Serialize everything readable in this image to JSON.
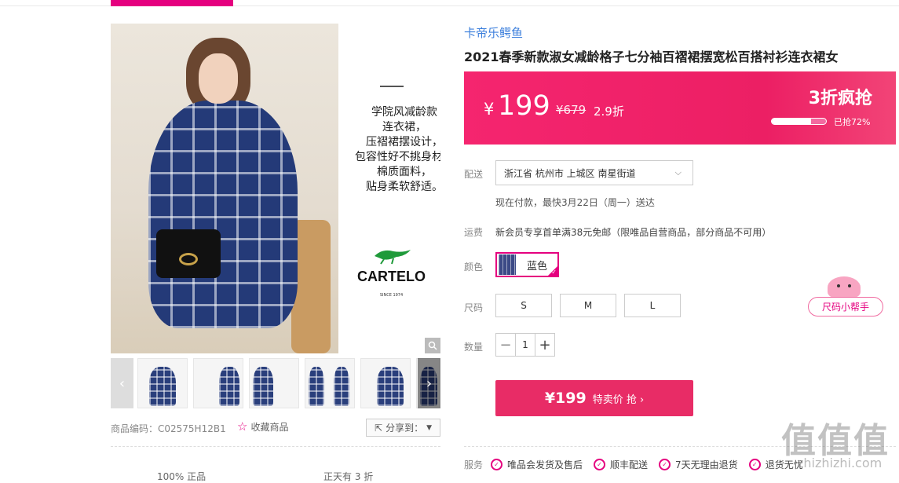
{
  "gallery": {
    "copy_lines": [
      "学院风减龄款",
      "连衣裙，",
      "压褶裙摆设计，",
      "包容性好不挑身材，",
      "棉质面料，",
      "贴身柔软舒适。"
    ],
    "logo_text": "CARTELO",
    "logo_since": "SINCE 1974",
    "prev_arrow": "‹",
    "next_arrow": "›",
    "zoom_icon": "magnifier-icon"
  },
  "meta": {
    "product_code": "商品编码：C02575H12B1",
    "favorite": "收藏商品",
    "share": "分享到："
  },
  "bottom_tabs": [
    "100% 正品",
    "正天有 3 折"
  ],
  "product": {
    "brand": "卡帝乐鳄鱼",
    "title": "2021春季新款淑女减龄格子七分袖百褶裙摆宽松百搭衬衫连衣裙女"
  },
  "price": {
    "currency": "¥",
    "value": "199",
    "original": "¥679",
    "discount": "2.9折",
    "promo": "3折疯抢",
    "sold_percent": 72,
    "sold_text": "已抢72%"
  },
  "delivery": {
    "label": "配送",
    "address": "浙江省 杭州市 上城区 南星街道",
    "time": "现在付款，最快3月22日（周一）送达"
  },
  "freight": {
    "label": "运费",
    "text": "新会员专享首单满38元免邮（限唯品自营商品，部分商品不可用）"
  },
  "color": {
    "label": "颜色",
    "selected": "蓝色"
  },
  "size": {
    "label": "尺码",
    "options": [
      "S",
      "M",
      "L"
    ]
  },
  "quantity": {
    "label": "数量",
    "value": "1",
    "minus": "−",
    "plus": "+"
  },
  "buy": {
    "price": "¥199",
    "label": "特卖价 抢 ›"
  },
  "services": {
    "label": "服务",
    "items": [
      "唯品会发货及售后",
      "顺丰配送",
      "7天无理由退货",
      "退货无忧"
    ]
  },
  "helper": {
    "label": "尺码小帮手"
  },
  "watermark": {
    "text": "值值值",
    "url": "zhizhizhi.com"
  },
  "colors": {
    "accent": "#e5007f",
    "price_bg": "#f5256f",
    "buy_bg": "#e82c66",
    "link": "#3c7fdc"
  }
}
